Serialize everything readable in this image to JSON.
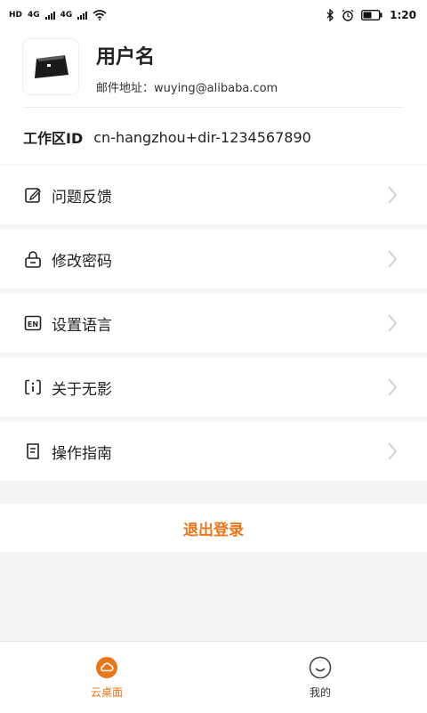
{
  "status_bar": {
    "left_chip": "HD",
    "net1": "4G",
    "net2": "4G",
    "time": "1:20"
  },
  "profile": {
    "username": "用户名",
    "email_label": "邮件地址：wuying@alibaba.com",
    "workspace_label": "工作区ID",
    "workspace_value": "cn-hangzhou+dir-1234567890"
  },
  "menu": {
    "items": [
      {
        "label": "问题反馈",
        "icon": "edit-icon"
      },
      {
        "label": "修改密码",
        "icon": "lock-icon"
      },
      {
        "label": "设置语言",
        "icon": "language-en-icon"
      },
      {
        "label": "关于无影",
        "icon": "info-icon"
      },
      {
        "label": "操作指南",
        "icon": "guide-icon"
      }
    ]
  },
  "logout_label": "退出登录",
  "tabbar": {
    "tabs": [
      {
        "label": "云桌面",
        "icon": "cloud-icon",
        "active": true
      },
      {
        "label": "我的",
        "icon": "smile-icon",
        "active": false
      }
    ]
  },
  "colors": {
    "accent": "#e7761d",
    "background": "#f3f4f6"
  }
}
